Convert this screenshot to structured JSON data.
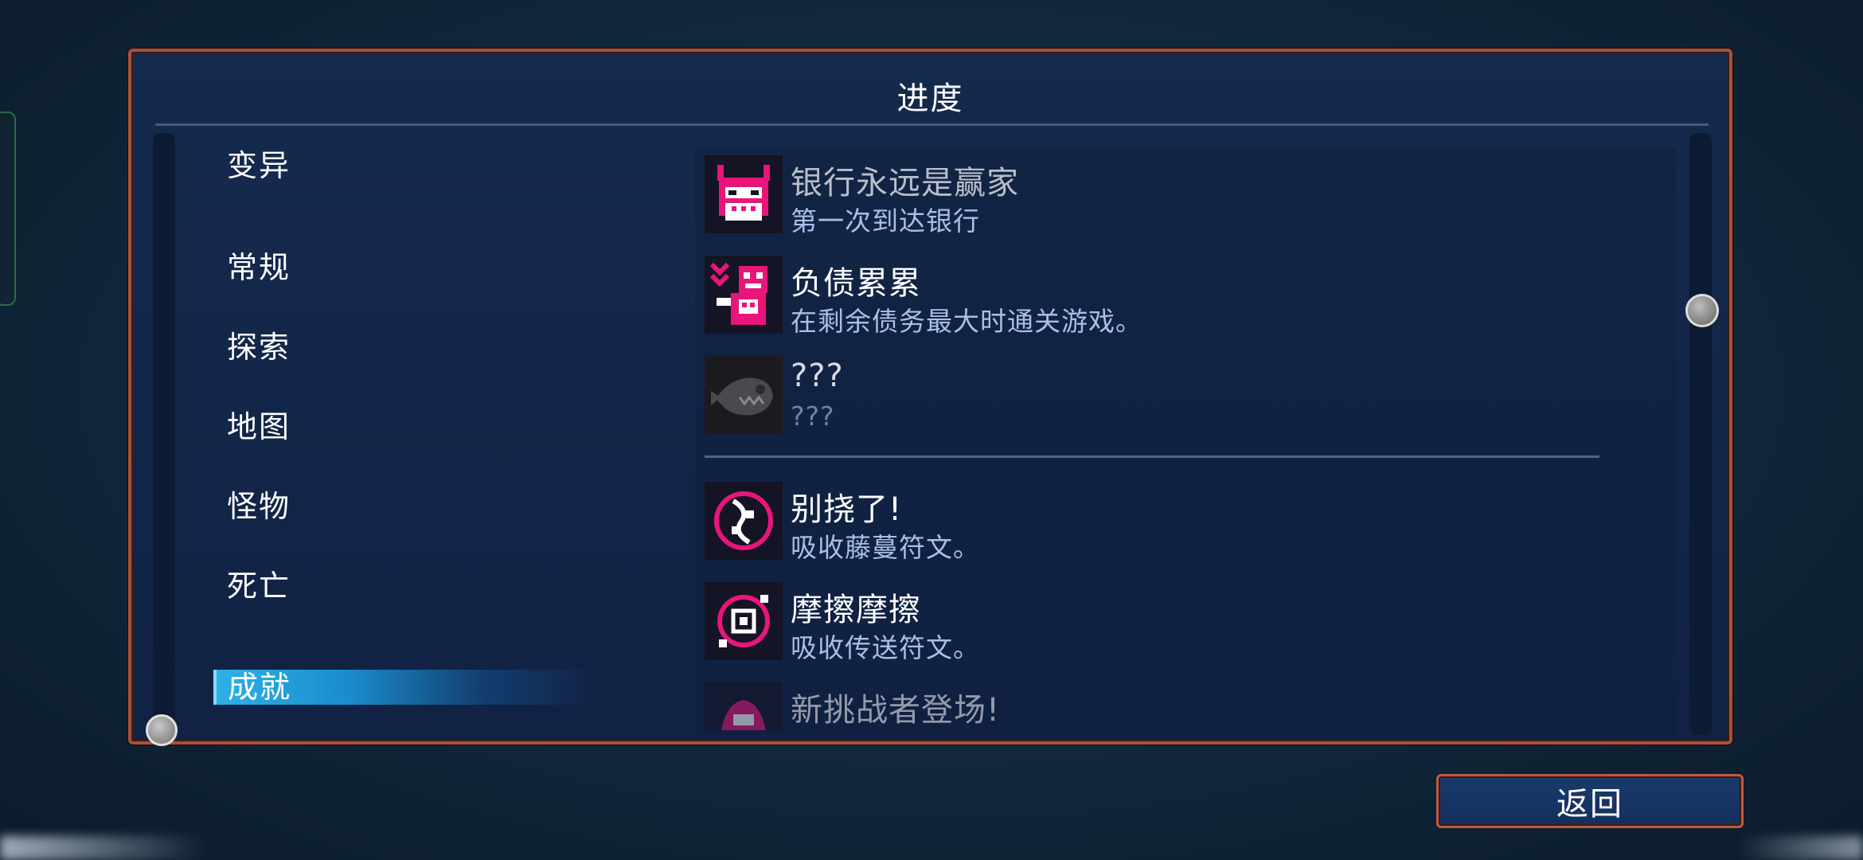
{
  "panel": {
    "title": "进度"
  },
  "nav": {
    "items": [
      {
        "label": "变异"
      },
      {
        "label": "常规"
      },
      {
        "label": "探索"
      },
      {
        "label": "地图"
      },
      {
        "label": "怪物"
      },
      {
        "label": "死亡"
      },
      {
        "label": "成就",
        "active": true
      }
    ]
  },
  "achievements": [
    {
      "name": "银行永远是赢家",
      "desc": "第一次到达银行",
      "icon": "bank-mask-icon",
      "state": "unlocked"
    },
    {
      "name": "负债累累",
      "desc": "在剩余债务最大时通关游戏。",
      "icon": "debt-creature-icon",
      "state": "unlocked"
    },
    {
      "name": "???",
      "desc": "???",
      "icon": "fish-skull-icon",
      "state": "locked"
    },
    {
      "name": "别挠了!",
      "desc": "吸收藤蔓符文。",
      "icon": "vine-rune-icon",
      "state": "unlocked"
    },
    {
      "name": "摩擦摩擦",
      "desc": "吸收传送符文。",
      "icon": "teleport-rune-icon",
      "state": "unlocked"
    },
    {
      "name": "新挑战者登场!",
      "desc": "",
      "icon": "challenger-icon",
      "state": "partial"
    }
  ],
  "buttons": {
    "back": "返回"
  },
  "colors": {
    "accent_pink": "#e8157a",
    "frame_orange": "#a5533c",
    "active_tab": "#2fb0e6"
  }
}
